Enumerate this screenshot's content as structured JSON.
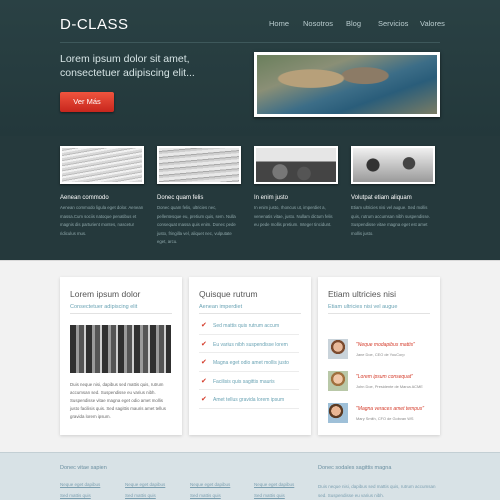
{
  "header": {
    "logo": "D-CLASS",
    "nav": [
      "Home",
      "Nosotros",
      "Blog",
      "Servicios",
      "Valores"
    ],
    "tagline": "Lorem ipsum dolor sit amet, consectetuer adipiscing elit...",
    "cta_label": "Ver Más"
  },
  "features": [
    {
      "title": "Aenean commodo",
      "text": "Aenean commodo ligula eget dolor. Aenean massa.Cum sociis natoque penatibus et magnis dis parturient montes, nascetur ridiculus mus."
    },
    {
      "title": "Donec quam felis",
      "text": "Donec quam felis, ultricies nec, pellentesque eu, pretium quis, sem. Nulla consequat massa quis enim. Donec pede justo, fringilla vel, aliquet nec, vulputate eget, arcu."
    },
    {
      "title": "In enim justo",
      "text": "In enim justo, rhoncus ut, imperdiet a, venenatis vitae, justo. Nullam dictum felis eu pede mollis pretium. Integer tincidunt."
    },
    {
      "title": "Volutpat etiam aliquam",
      "text": "Etiam ultricies nisi vel augue. Sed mollis quis, rutrum accumsan nibh suspendisse. Suspendisse vitae magna eget est amet mollis justo."
    }
  ],
  "card1": {
    "title": "Lorem ipsum dolor",
    "subtitle": "Consectetuer adipiscing elit",
    "text": "Duis neque nisi, dapibus sed mattis quis, rutrum accumsan sed. Suspendisse eu varius nibh. Suspendisse vitae magna eget odio amet mollis justo facilisis quis. Sed sagittis mauris amet tellus gravida lorem ipsum."
  },
  "card2": {
    "title": "Quisque rutrum",
    "subtitle": "Aenean imperdiet",
    "items": [
      "Sed mattis quis rutrum accum",
      "Eu varius nibh suspendisse lorem",
      "Magna eget odio amet mollis justo",
      "Facilisis quis sagittis mauris",
      "Amet tellus gravida lorem ipsum"
    ]
  },
  "card3": {
    "title": "Etiam ultricies nisi",
    "subtitle": "Etiam ultricies nisi vel augue",
    "testimonials": [
      {
        "quote": "\"Neque modapibus mattis\"",
        "author": "Jane Doe, CEO de YouCorp"
      },
      {
        "quote": "\"Lorem ipsum consequat\"",
        "author": "John Doe, Presidente de Marca ACME"
      },
      {
        "quote": "\"Magna veraces amet tempus\"",
        "author": "Mary Smith, CFO de Gobvan WS"
      }
    ]
  },
  "footer": {
    "col1_title": "Donec vitae sapien",
    "links_a": [
      "Neque eget dapibus",
      "Sed mattis quis"
    ],
    "links_b": [
      "Neque eget dapibus",
      "Sed mattis quis"
    ],
    "links_c": [
      "Neque eget dapibus",
      "Sed mattis quis"
    ],
    "links_d": [
      "Neque eget dapibus",
      "Sed mattis quis"
    ],
    "col2_title": "Donec sodales sagittis magna",
    "col2_text": "Duis neque nisi, dapibus sed mattis quis, rutrum accumsan sed. Suspendisse eu varius nibh."
  },
  "colors": {
    "accent": "#d43b2a",
    "teal_dark": "#25393c",
    "link_blue": "#6aa3b4"
  }
}
